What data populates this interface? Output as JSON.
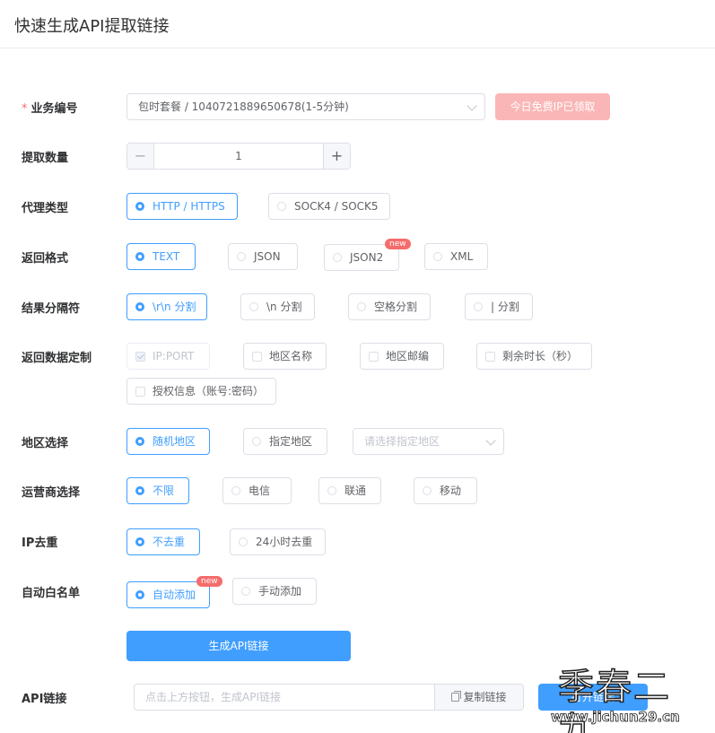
{
  "header": {
    "title": "快速生成API提取链接"
  },
  "business": {
    "label": "业务编号",
    "required_mark": "*",
    "select_value": "包时套餐 / 1040721889650678(1-5分钟)",
    "free_ip_button": "今日免费IP已领取"
  },
  "quantity": {
    "label": "提取数量",
    "value": "1",
    "minus": "−",
    "plus": "+"
  },
  "proxy_type": {
    "label": "代理类型",
    "options": [
      "HTTP / HTTPS",
      "SOCK4 / SOCK5"
    ],
    "selected": "HTTP / HTTPS"
  },
  "format": {
    "label": "返回格式",
    "options": [
      "TEXT",
      "JSON",
      "JSON2",
      "XML"
    ],
    "selected": "TEXT",
    "new_badge": "new"
  },
  "separator": {
    "label": "结果分隔符",
    "options": [
      "\\r\\n 分割",
      "\\n 分割",
      "空格分割",
      "| 分割"
    ],
    "selected": "\\r\\n 分割"
  },
  "custom": {
    "label": "返回数据定制",
    "options": [
      "IP:PORT",
      "地区名称",
      "地区邮编",
      "剩余时长（秒）",
      "授权信息（账号:密码）"
    ],
    "checked": "IP:PORT"
  },
  "region": {
    "label": "地区选择",
    "options": [
      "随机地区",
      "指定地区"
    ],
    "selected": "随机地区",
    "select_placeholder": "请选择指定地区"
  },
  "isp": {
    "label": "运营商选择",
    "options": [
      "不限",
      "电信",
      "联通",
      "移动"
    ],
    "selected": "不限"
  },
  "dedup": {
    "label": "IP去重",
    "options": [
      "不去重",
      "24小时去重"
    ],
    "selected": "不去重"
  },
  "whitelist": {
    "label": "自动白名单",
    "options": [
      "自动添加",
      "手动添加"
    ],
    "selected": "自动添加",
    "new_badge": "new"
  },
  "generate": {
    "button": "生成API链接"
  },
  "api": {
    "label": "API链接",
    "placeholder": "点击上方按钮，生成API链接",
    "copy_button": "复制链接",
    "open_button": "打开链接"
  },
  "watermark": {
    "big": "季春二九",
    "small": "www.jichun29.cn"
  },
  "colors": {
    "primary": "#409eff",
    "danger": "#f56c6c",
    "disabled_danger": "#fab6b6"
  }
}
